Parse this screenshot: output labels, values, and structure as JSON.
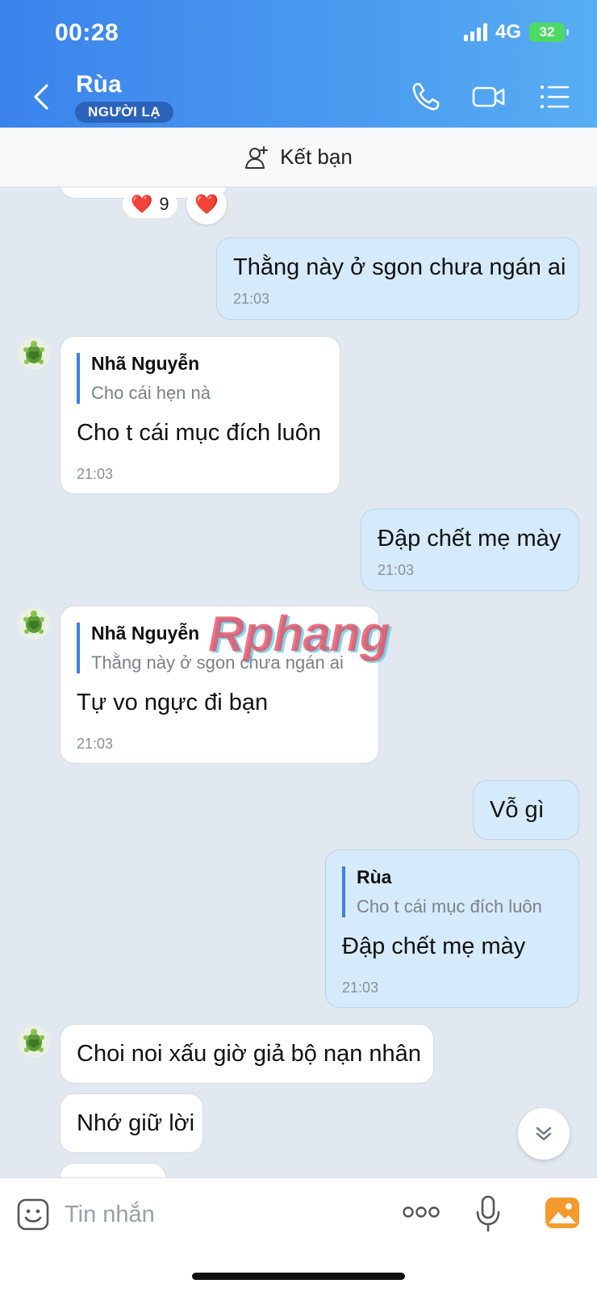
{
  "status": {
    "time": "00:28",
    "network": "4G",
    "battery": "32"
  },
  "header": {
    "title": "Rùa",
    "badge": "NGƯỜI LẠ"
  },
  "add_friend": {
    "label": "Kết bạn"
  },
  "reaction": {
    "emoji": "❤️",
    "count": "9",
    "react_emoji": "❤️"
  },
  "messages": [
    {
      "side": "out",
      "text": "Thằng này ở sgon chưa ngán ai",
      "time": "21:03"
    },
    {
      "side": "in",
      "quote_name": "Nhã Nguyễn",
      "quote_text": "Cho cái hẹn nà",
      "text": "Cho t cái mục đích luôn",
      "time": "21:03"
    },
    {
      "side": "out",
      "text": "Đập chết mẹ mày",
      "time": "21:03"
    },
    {
      "side": "in",
      "quote_name": "Nhã Nguyễn",
      "quote_text": "Thằng này ở sgon chưa ngán ai",
      "text": "Tự vo ngực đi bạn",
      "time": "21:03"
    },
    {
      "side": "out",
      "text": "Vỗ gì"
    },
    {
      "side": "out",
      "quote_name": "Rùa",
      "quote_text": "Cho t cái mục đích luôn",
      "text": "Đập chết mẹ mày",
      "time": "21:03"
    },
    {
      "side": "in",
      "text": "Choi noi xấu giờ giả bộ nạn nhân"
    },
    {
      "side": "in",
      "text": "Nhớ giữ lời"
    }
  ],
  "watermark": "Rphang",
  "composer": {
    "placeholder": "Tin nhắn"
  },
  "colors": {
    "header_blue": "#3b83ec",
    "out_bubble": "#d5ebfb",
    "in_bubble": "#ffffff",
    "quote_bar": "#3f7fdc",
    "badge": "#2a63b8"
  }
}
